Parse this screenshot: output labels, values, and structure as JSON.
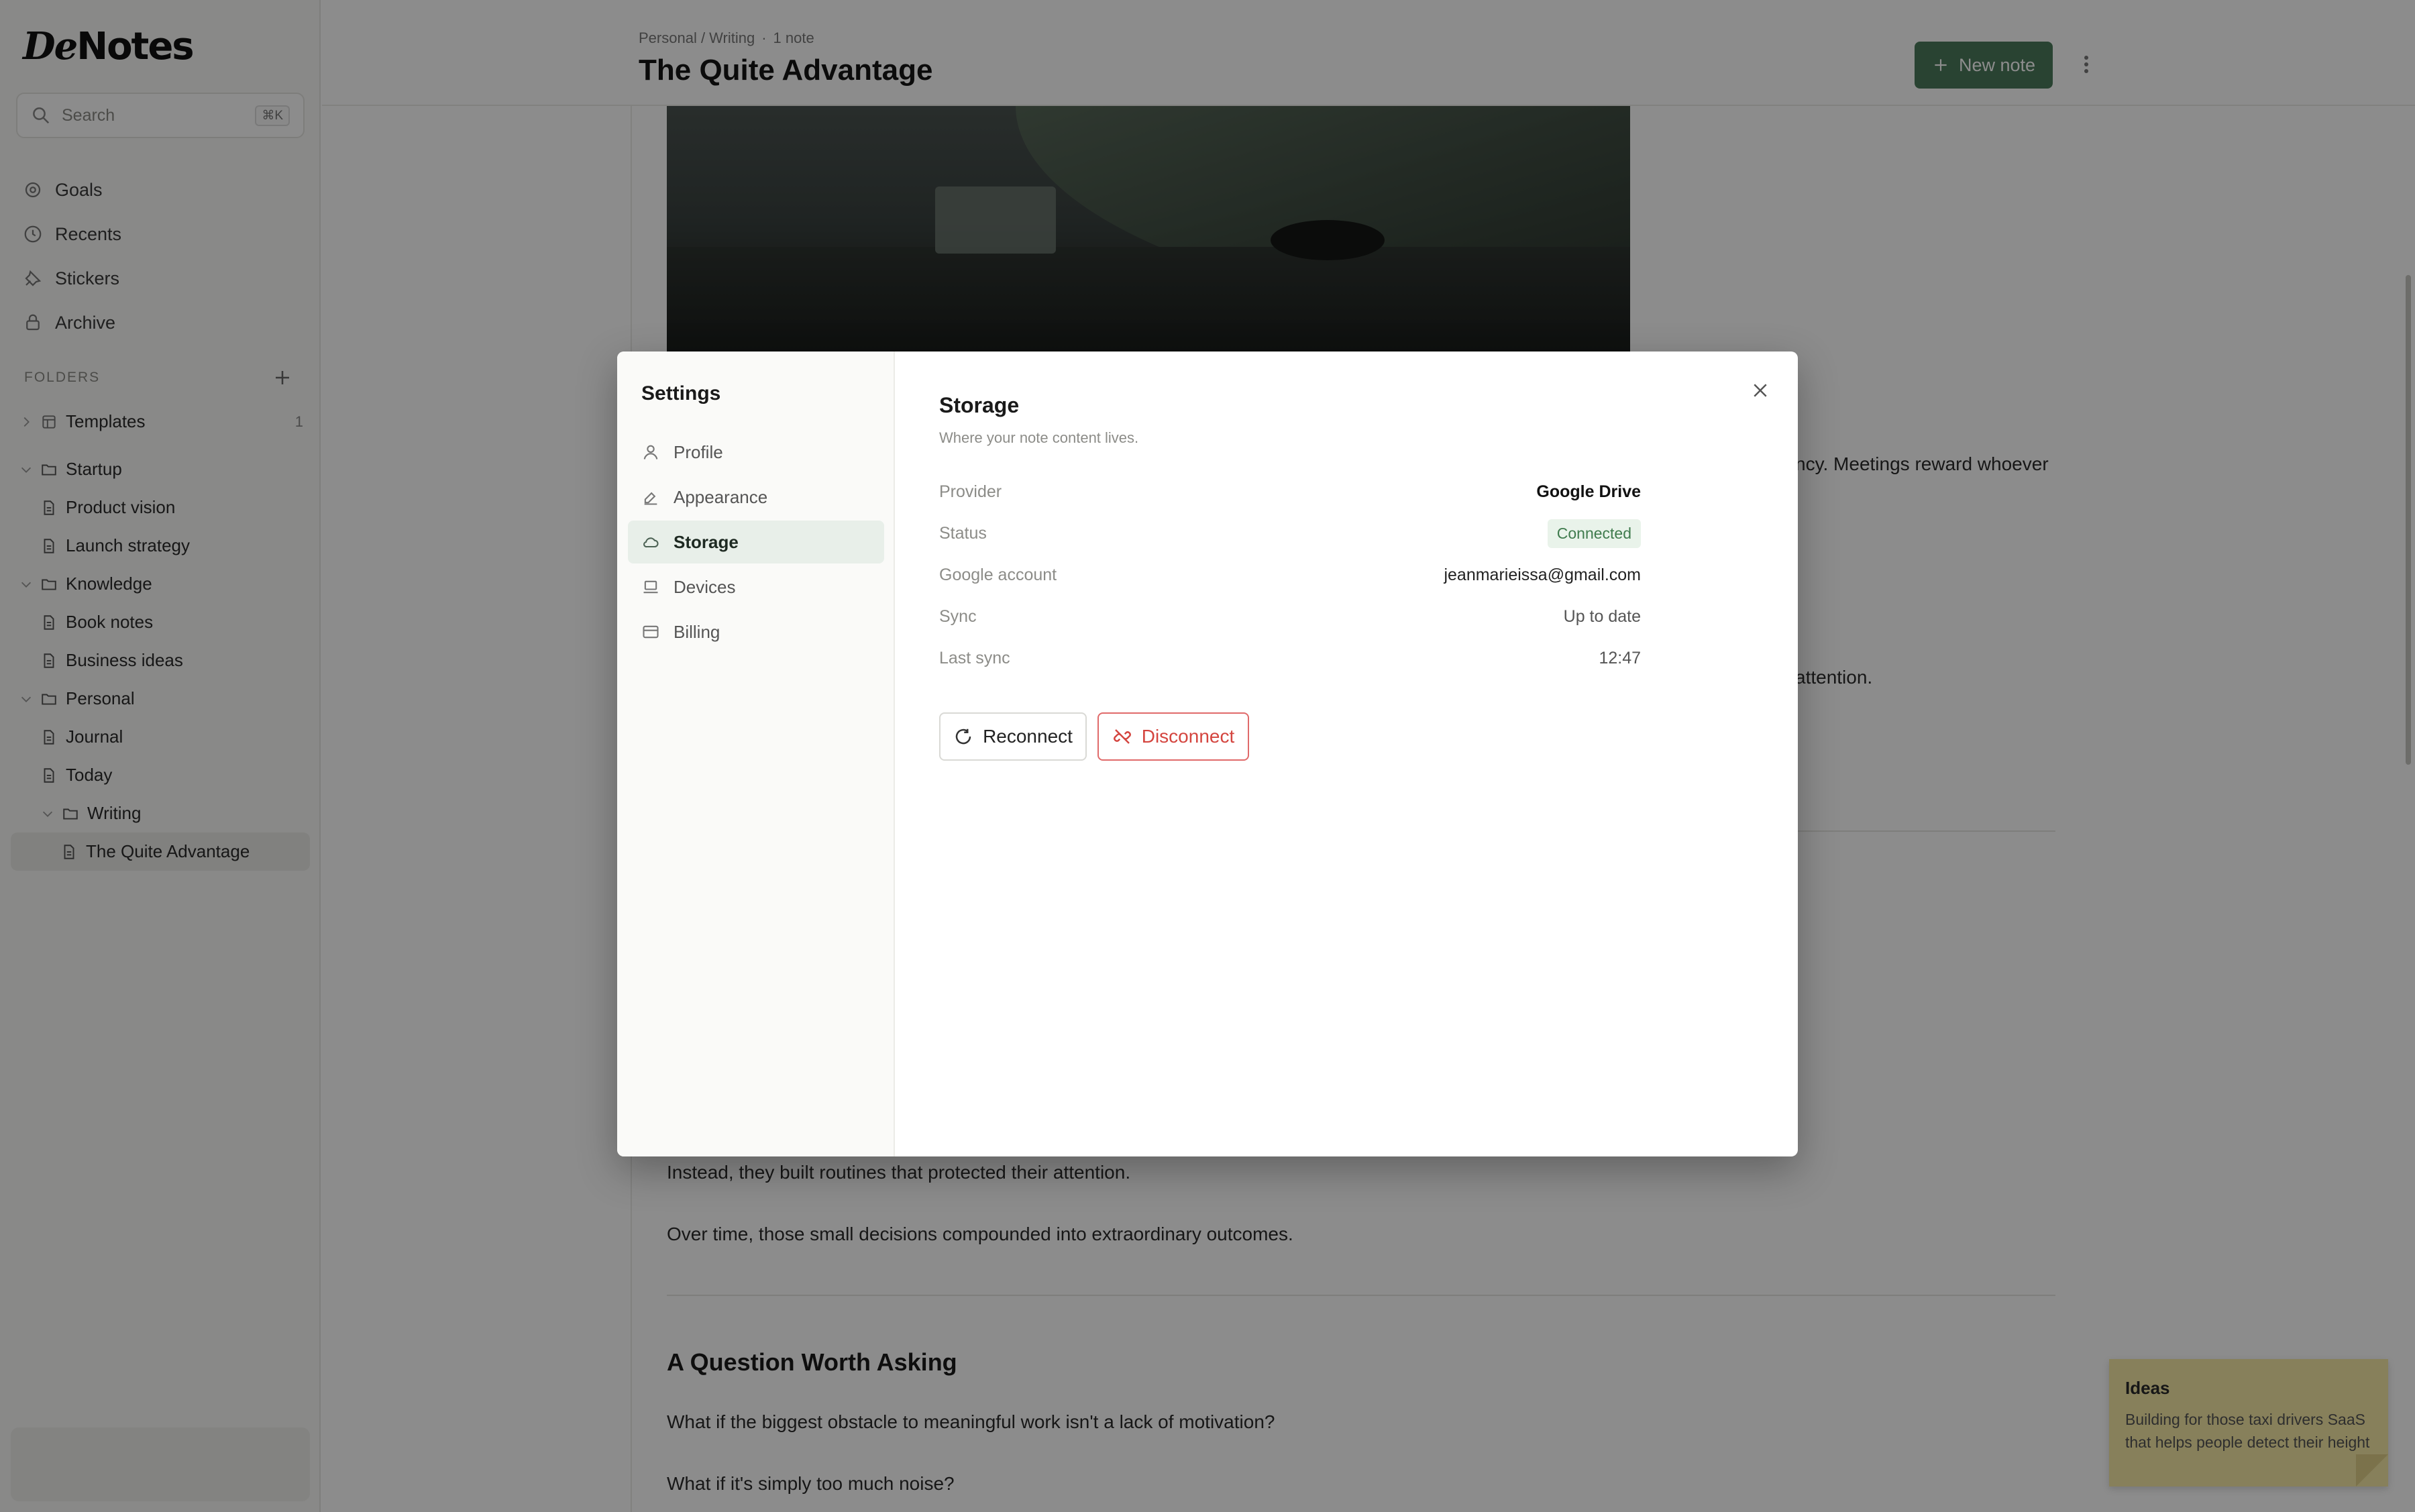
{
  "app": {
    "logo_prefix": "De",
    "logo_suffix": "Notes"
  },
  "sidebar": {
    "search_placeholder": "Search",
    "search_shortcut": "⌘K",
    "nav": [
      {
        "label": "Goals",
        "icon": "target-icon"
      },
      {
        "label": "Recents",
        "icon": "clock-icon"
      },
      {
        "label": "Stickers",
        "icon": "pin-icon"
      },
      {
        "label": "Archive",
        "icon": "archive-icon"
      }
    ],
    "folders_label": "FOLDERS",
    "tree": [
      {
        "label": "Templates",
        "count": "1"
      },
      {
        "label": "Startup"
      },
      {
        "label": "Product vision"
      },
      {
        "label": "Launch strategy"
      },
      {
        "label": "Knowledge"
      },
      {
        "label": "Book notes"
      },
      {
        "label": "Business ideas"
      },
      {
        "label": "Personal"
      },
      {
        "label": "Journal"
      },
      {
        "label": "Today"
      },
      {
        "label": "Writing"
      },
      {
        "label": "The Quite Advantage"
      }
    ]
  },
  "header": {
    "breadcrumb": "Personal / Writing",
    "note_count": "1 note",
    "title": "The Quite Advantage",
    "new_note_label": "New note"
  },
  "editor": {
    "partial_line_1": "ncy. Meetings reward whoever",
    "partial_line_2": "attention.",
    "para_1": "Instead, they built routines that protected their attention.",
    "para_2": "Over time, those small decisions compounded into extraordinary outcomes.",
    "heading": "A Question Worth Asking",
    "para_3": "What if the biggest obstacle to meaningful work isn't a lack of motivation?",
    "para_4": "What if it's simply too much noise?"
  },
  "sticky": {
    "title": "Ideas",
    "body": "Building for those taxi drivers SaaS that helps people detect their height"
  },
  "settings": {
    "title": "Settings",
    "menu": [
      {
        "label": "Profile",
        "icon": "user-icon"
      },
      {
        "label": "Appearance",
        "icon": "paint-icon"
      },
      {
        "label": "Storage",
        "icon": "cloud-icon"
      },
      {
        "label": "Devices",
        "icon": "laptop-icon"
      },
      {
        "label": "Billing",
        "icon": "card-icon"
      }
    ],
    "active_item": "Storage",
    "section_title": "Storage",
    "section_subtitle": "Where your note content lives.",
    "rows": {
      "provider_label": "Provider",
      "provider_value": "Google Drive",
      "status_label": "Status",
      "status_value": "Connected",
      "account_label": "Google account",
      "account_value": "jeanmarieissa@gmail.com",
      "sync_label": "Sync",
      "sync_value": "Up to date",
      "last_sync_label": "Last sync",
      "last_sync_value": "12:47"
    },
    "reconnect_label": "Reconnect",
    "disconnect_label": "Disconnect"
  },
  "colors": {
    "accent": "#4c7a5b",
    "connected": "#3f7b4d",
    "danger": "#d4453f",
    "sticky": "#f6e9a6"
  }
}
